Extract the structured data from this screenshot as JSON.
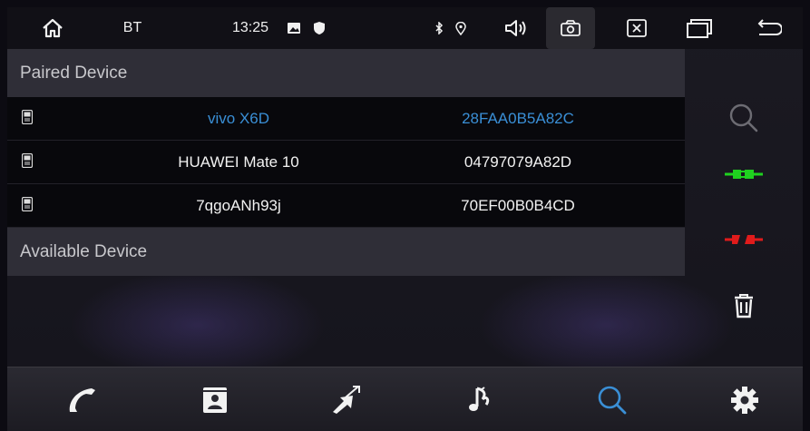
{
  "status_bar": {
    "app_label": "BT",
    "time": "13:25",
    "icons": [
      "home-icon",
      "image-icon",
      "shield-icon",
      "bluetooth-icon",
      "location-icon",
      "volume-icon",
      "screenshot-icon",
      "close-window-icon",
      "recent-apps-icon",
      "back-icon"
    ]
  },
  "paired": {
    "header": "Paired Device",
    "devices": [
      {
        "name": "vivo X6D",
        "address": "28FAA0B5A82C",
        "selected": true
      },
      {
        "name": "HUAWEI Mate 10",
        "address": "04797079A82D",
        "selected": false
      },
      {
        "name": "7qgoANh93j",
        "address": "70EF00B0B4CD",
        "selected": false
      }
    ]
  },
  "available": {
    "header": "Available Device"
  },
  "side_actions": [
    "search-icon",
    "connect-icon",
    "disconnect-icon",
    "delete-icon"
  ],
  "bottom_nav": [
    "phone-icon",
    "contacts-icon",
    "transfer-icon",
    "music-icon",
    "search-icon",
    "settings-icon"
  ],
  "colors": {
    "accent": "#3a8fd6",
    "connect": "#1fd11f",
    "disconnect": "#e01b1b"
  }
}
